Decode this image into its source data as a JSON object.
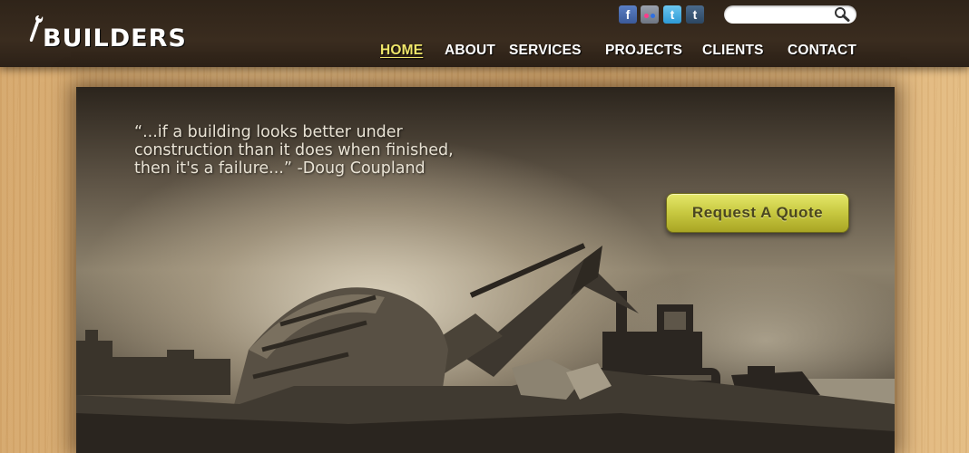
{
  "header": {
    "logo_text": "BUILDERS"
  },
  "social": {
    "facebook_glyph": "f",
    "twitter_glyph": "t",
    "tumblr_glyph": "t"
  },
  "search": {
    "value": "",
    "placeholder": ""
  },
  "nav": {
    "items": [
      {
        "label": "HOME",
        "active": true
      },
      {
        "label": "ABOUT"
      },
      {
        "label": "SERVICES"
      },
      {
        "label": "PROJECTS"
      },
      {
        "label": "CLIENTS"
      },
      {
        "label": "CONTACT"
      }
    ]
  },
  "hero": {
    "quote_line1": "“...if a building looks better under",
    "quote_line2": "construction than it does when finished,",
    "quote_line3": "then it's a failure...” -Doug Coupland",
    "cta_label": "Request A Quote"
  },
  "colors": {
    "header_bg": "#33271c",
    "nav_active": "#f0e66a",
    "cta": "#c7c840"
  }
}
